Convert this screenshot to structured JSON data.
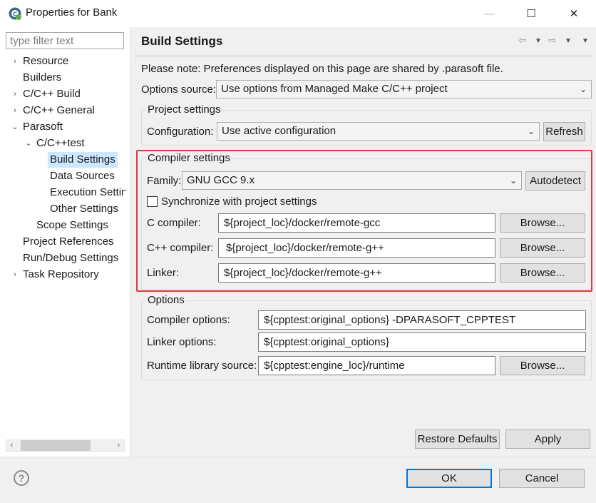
{
  "window": {
    "title": "Properties for Bank",
    "minimize": "—",
    "maximize": "☐",
    "close": "✕"
  },
  "sidebar": {
    "filter_placeholder": "type filter text",
    "items": [
      {
        "label": "Resource",
        "arrow": "›"
      },
      {
        "label": "Builders",
        "arrow": ""
      },
      {
        "label": "C/C++ Build",
        "arrow": "›"
      },
      {
        "label": "C/C++ General",
        "arrow": "›"
      },
      {
        "label": "Parasoft",
        "arrow": "⌄"
      },
      {
        "label": "C/C++test",
        "arrow": "⌄"
      },
      {
        "label": "Build Settings",
        "arrow": ""
      },
      {
        "label": "Data Sources",
        "arrow": ""
      },
      {
        "label": "Execution Settin",
        "arrow": ""
      },
      {
        "label": "Other Settings",
        "arrow": ""
      },
      {
        "label": "Scope Settings",
        "arrow": ""
      },
      {
        "label": "Project References",
        "arrow": ""
      },
      {
        "label": "Run/Debug Settings",
        "arrow": ""
      },
      {
        "label": "Task Repository",
        "arrow": "›"
      }
    ],
    "scroll_left": "‹",
    "scroll_right": "›"
  },
  "page": {
    "title": "Build Settings",
    "note": "Please note: Preferences displayed on this page are shared by .parasoft file.",
    "options_source_label": "Options source:",
    "options_source_value": "Use options from Managed Make C/C++ project",
    "project_settings": {
      "title": "Project settings",
      "configuration_label": "Configuration:",
      "configuration_value": "Use active configuration",
      "refresh": "Refresh"
    },
    "compiler_settings": {
      "title": "Compiler settings",
      "family_label": "Family:",
      "family_value": "GNU GCC 9.x",
      "autodetect": "Autodetect",
      "sync_label": "Synchronize with project settings",
      "c_compiler_label": "C compiler:",
      "c_compiler_value": "${project_loc}/docker/remote-gcc",
      "cpp_compiler_label": "C++ compiler:",
      "cpp_compiler_value": "${project_loc}/docker/remote-g++",
      "linker_label": "Linker:",
      "linker_value": "${project_loc}/docker/remote-g++",
      "browse": "Browse..."
    },
    "options": {
      "title": "Options",
      "compiler_options_label": "Compiler options:",
      "compiler_options_value": "${cpptest:original_options} -DPARASOFT_CPPTEST",
      "linker_options_label": "Linker options:",
      "linker_options_value": "${cpptest:original_options}",
      "runtime_label": "Runtime library source:",
      "runtime_value": "${cpptest:engine_loc}/runtime",
      "browse": "Browse..."
    },
    "restore_defaults": "Restore Defaults",
    "apply": "Apply"
  },
  "footer": {
    "help": "?",
    "ok": "OK",
    "cancel": "Cancel"
  },
  "colors": {
    "highlight_border": "#e0393e",
    "selection": "#cce8ff",
    "primary_border": "#0078d7"
  }
}
